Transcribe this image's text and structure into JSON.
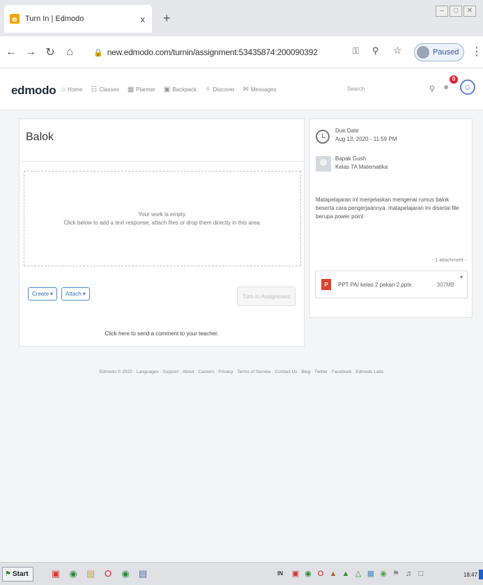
{
  "browser": {
    "tab_title": "Turn In | Edmodo",
    "tab_close": "x",
    "new_tab": "+",
    "url": "new.edmodo.com/turnin/assignment:53435874:200090392",
    "profile_status": "Paused",
    "window_controls": [
      "minimize",
      "maximize",
      "close"
    ]
  },
  "header": {
    "logo": "edmodo",
    "nav": [
      {
        "label": "Home",
        "icon": "home-icon"
      },
      {
        "label": "Classes",
        "icon": "classes-icon"
      },
      {
        "label": "Planner",
        "icon": "planner-icon"
      },
      {
        "label": "Backpack",
        "icon": "backpack-icon"
      },
      {
        "label": "Discover",
        "icon": "discover-icon"
      },
      {
        "label": "Messages",
        "icon": "messages-icon"
      }
    ],
    "search_placeholder": "Search",
    "notification_count": "0"
  },
  "assignment": {
    "title": "Balok",
    "empty_line1": "Your work is empty.",
    "empty_line2": "Click below to add a text response, attach files or drop them directly in this area.",
    "create_label": "Create",
    "attach_label": "Attach",
    "turn_in_label": "Turn In Assignment",
    "comment_link": "Click here to send a comment to your teacher."
  },
  "details": {
    "due_label": "Due Date",
    "due_value": "Aug 13, 2020 - 11:59 PM",
    "teacher_name": "Bapak Gush",
    "class_name": "Kelas 7A Matematika",
    "description": "Matapelajaran ini menjelaskan mengenai rumus balok beserta cara pengerjaannya. matapelajaran ini disertai file berupa power point",
    "attachment_count": "- 1 attachment -",
    "attachment": {
      "name": "PPT PAI kelas 2 pekan 2.pptx",
      "size": "307MB",
      "icon": "P"
    }
  },
  "footer": {
    "text": "Edmodo © 2020 · Languages · Support · About · Careers · Privacy · Terms of Service · Contact Us · Blog · Twitter · Facebook · Edmodo Labs"
  },
  "taskbar": {
    "start_label": "Start",
    "tray_lang": "IN",
    "time": "18:47"
  },
  "colors": {
    "accent": "#4f88d1",
    "badge": "#e0243a",
    "ppt": "#d9432c"
  }
}
